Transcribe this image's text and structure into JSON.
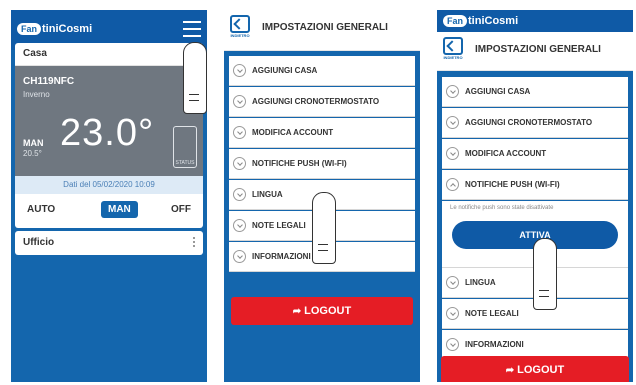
{
  "brand": {
    "badge": "Fan",
    "name": "tiniCosmi"
  },
  "screen1": {
    "home_title": "Casa",
    "thermostat": {
      "model": "CH119NFC",
      "season": "Inverno",
      "temperature": "23.0°",
      "mode": "MAN",
      "setpoint": "20.5°",
      "status_label": "STATUS",
      "date_text": "Dati del 05/02/2020 10:09"
    },
    "modes": {
      "auto": "AUTO",
      "man": "MAN",
      "off": "OFF"
    },
    "second_home": "Ufficio"
  },
  "settings": {
    "back_label": "INDIETRO",
    "title": "IMPOSTAZIONI GENERALI",
    "items": [
      "AGGIUNGI CASA",
      "AGGIUNGI CRONOTERMOSTATO",
      "MODIFICA ACCOUNT",
      "NOTIFICHE PUSH (WI-FI)",
      "LINGUA",
      "NOTE LEGALI",
      "INFORMAZIONI"
    ],
    "logout": "LOGOUT",
    "push_message": "Le notifiche push sono state disattivate",
    "activate": "ATTIVA"
  },
  "colors": {
    "primary": "#1466ad",
    "logout": "#e51d25"
  }
}
